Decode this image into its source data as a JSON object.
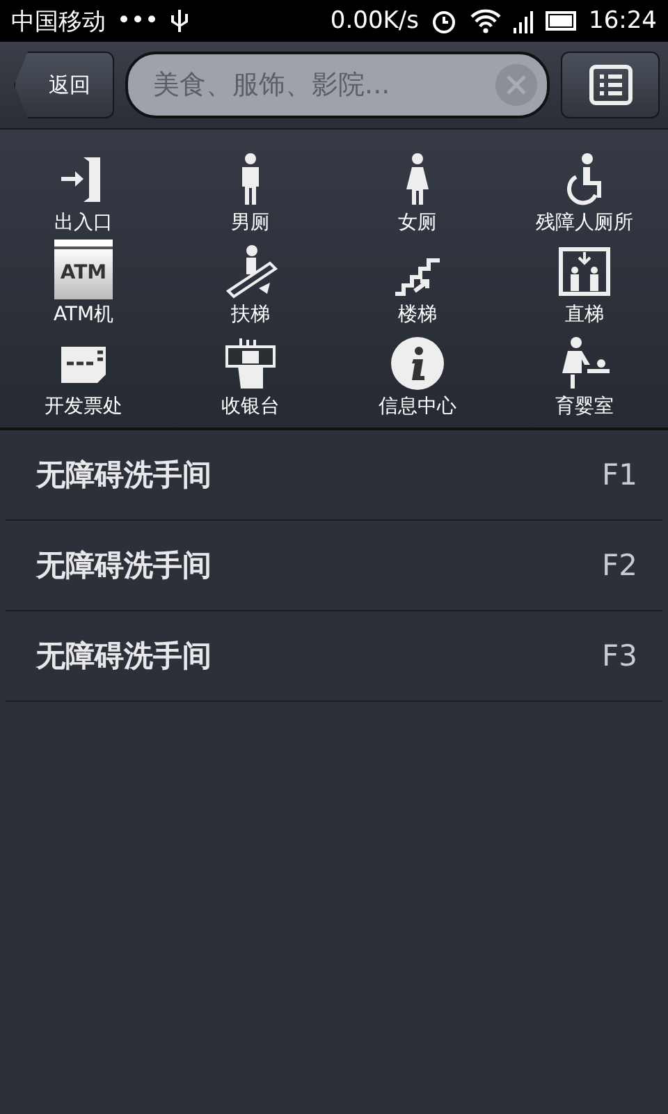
{
  "status_bar": {
    "carrier": "中国移动",
    "dots": "•••",
    "speed": "0.00K/s",
    "time": "16:24"
  },
  "header": {
    "back": "返回",
    "search": {
      "placeholder": "美食、服饰、影院..."
    }
  },
  "facilities": [
    {
      "kind": "exit",
      "label": "出入口"
    },
    {
      "kind": "men",
      "label": "男厕"
    },
    {
      "kind": "women",
      "label": "女厕"
    },
    {
      "kind": "accessible",
      "label": "残障人厕所"
    },
    {
      "kind": "atm",
      "label": "ATM机",
      "icon_text": "ATM"
    },
    {
      "kind": "escalator",
      "label": "扶梯"
    },
    {
      "kind": "stairs",
      "label": "楼梯"
    },
    {
      "kind": "elevator",
      "label": "直梯"
    },
    {
      "kind": "invoice",
      "label": "开发票处"
    },
    {
      "kind": "cashier",
      "label": "收银台"
    },
    {
      "kind": "info",
      "label": "信息中心"
    },
    {
      "kind": "baby",
      "label": "育婴室"
    }
  ],
  "results": [
    {
      "name": "无障碍洗手间",
      "floor": "F1"
    },
    {
      "name": "无障碍洗手间",
      "floor": "F2"
    },
    {
      "name": "无障碍洗手间",
      "floor": "F3"
    }
  ]
}
